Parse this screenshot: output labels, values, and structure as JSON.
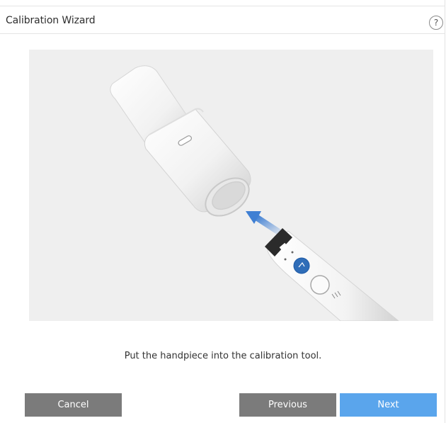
{
  "window": {
    "title": "Calibration Wizard",
    "help_label": "?"
  },
  "illustration": {
    "icon": "handpiece-calibration-illustration",
    "arrow_color": "#3f7fd3",
    "button_color": "#2f6db8"
  },
  "instruction": "Put the handpiece into the calibration tool.",
  "buttons": {
    "cancel": "Cancel",
    "previous": "Previous",
    "next": "Next"
  },
  "colors": {
    "secondary_button": "#7b7b7b",
    "primary_button": "#5aa5ec",
    "illustration_bg": "#efefef"
  }
}
